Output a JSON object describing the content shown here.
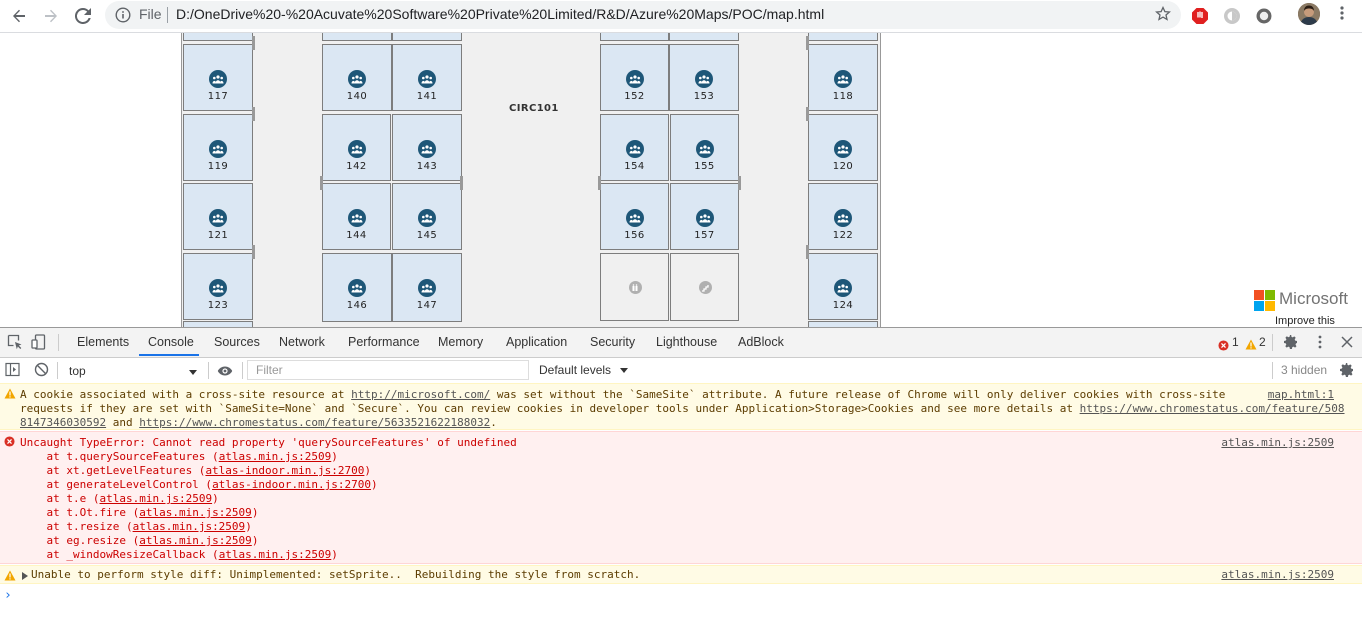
{
  "browser": {
    "file_label": "File",
    "url": "D:/OneDrive%20-%20Acuvate%20Software%20Private%20Limited/R&D/Azure%20Maps/POC/map.html"
  },
  "map": {
    "corridor_label": "CIRC101",
    "rooms": {
      "r117": "117",
      "r119": "119",
      "r121": "121",
      "r123": "123",
      "r140": "140",
      "r141": "141",
      "r142": "142",
      "r143": "143",
      "r144": "144",
      "r145": "145",
      "r146": "146",
      "r147": "147",
      "r152": "152",
      "r153": "153",
      "r154": "154",
      "r155": "155",
      "r156": "156",
      "r157": "157",
      "r118": "118",
      "r120": "120",
      "r122": "122",
      "r124": "124"
    },
    "brand": "Microsoft",
    "improve_link": "Improve this map",
    "colors": {
      "room_fill": "#dbe7f3",
      "room_icon": "#1e5778",
      "floor": "#f0f0f0"
    }
  },
  "devtools": {
    "tabs": [
      "Elements",
      "Console",
      "Sources",
      "Network",
      "Performance",
      "Memory",
      "Application",
      "Security",
      "Lighthouse",
      "AdBlock"
    ],
    "active_tab": "Console",
    "error_count": "1",
    "warning_count": "2",
    "context": "top",
    "filter_placeholder": "Filter",
    "levels": "Default levels",
    "hidden": "3 hidden",
    "messages": {
      "cookie": {
        "line1_a": "A cookie associated with a cross-site resource at ",
        "line1_link": "http://microsoft.com/",
        "line1_b": " was set without the `SameSite` attribute. A future release of Chrome will only deliver cookies with cross-site",
        "line2_a": "requests if they are set with `SameSite=None` and `Secure`. You can review cookies in developer tools under Application>Storage>Cookies and see more details at ",
        "line2_link": "https://www.chromestatus.com/feature/508",
        "line3_link1": "8147346030592",
        "line3_and": " and ",
        "line3_link2": "https://www.chromestatus.com/feature/5633521622188032",
        "line3_end": ".",
        "source": "map.html:1"
      },
      "error": {
        "title": "Uncaught TypeError: Cannot read property 'querySourceFeatures' of undefined",
        "stack": [
          {
            "fn": "    at t.querySourceFeatures (",
            "loc": "atlas.min.js:2509",
            "end": ")"
          },
          {
            "fn": "    at xt.getLevelFeatures (",
            "loc": "atlas-indoor.min.js:2700",
            "end": ")"
          },
          {
            "fn": "    at generateLevelControl (",
            "loc": "atlas-indoor.min.js:2700",
            "end": ")"
          },
          {
            "fn": "    at t.e (",
            "loc": "atlas.min.js:2509",
            "end": ")"
          },
          {
            "fn": "    at t.Ot.fire (",
            "loc": "atlas.min.js:2509",
            "end": ")"
          },
          {
            "fn": "    at t.resize (",
            "loc": "atlas.min.js:2509",
            "end": ")"
          },
          {
            "fn": "    at eg.resize (",
            "loc": "atlas.min.js:2509",
            "end": ")"
          },
          {
            "fn": "    at _windowResizeCallback (",
            "loc": "atlas.min.js:2509",
            "end": ")"
          }
        ],
        "source": "atlas.min.js:2509"
      },
      "style": {
        "text": "Unable to perform style diff: Unimplemented: setSprite..  Rebuilding the style from scratch.",
        "source": "atlas.min.js:2509"
      }
    }
  }
}
